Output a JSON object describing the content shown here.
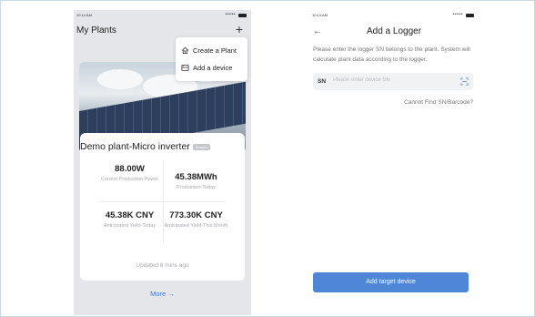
{
  "left_screen": {
    "status_time": "10:14 AM",
    "status_signal": "•••••",
    "title": "My Plants",
    "plus_glyph": "+",
    "menu": [
      {
        "label": "Create a Plant",
        "icon": "plant-icon"
      },
      {
        "label": "Add a device",
        "icon": "device-icon"
      }
    ],
    "plant": {
      "name": "Demo plant-Micro inverter",
      "badge": "Shared",
      "stats": [
        {
          "value": "88.00W",
          "label": "Current Production Power"
        },
        {
          "value": "45.38MWh",
          "label": "Production-Today"
        },
        {
          "value": "45.38K CNY",
          "label": "Anticipated Yield-Today"
        },
        {
          "value": "773.30K CNY",
          "label": "Anticipated Yield-This Month"
        }
      ],
      "updated": "Updated 8 mins ago"
    },
    "more": "More →"
  },
  "right_screen": {
    "status_time": "10:14 AM",
    "status_signal": "•••••",
    "back_glyph": "←",
    "title": "Add a Logger",
    "description": "Please enter the logger SN belongs to the plant. System will calculate plant data according to the logger.",
    "sn_label": "SN",
    "sn_placeholder": "Please enter device SN",
    "cannot_find": "Cannot Find SN/Barcode?",
    "button": "Add target device"
  },
  "colors": {
    "accent": "#4f86d6",
    "link": "#3e7ad8",
    "dim_overlay": "#e4e6e9"
  }
}
